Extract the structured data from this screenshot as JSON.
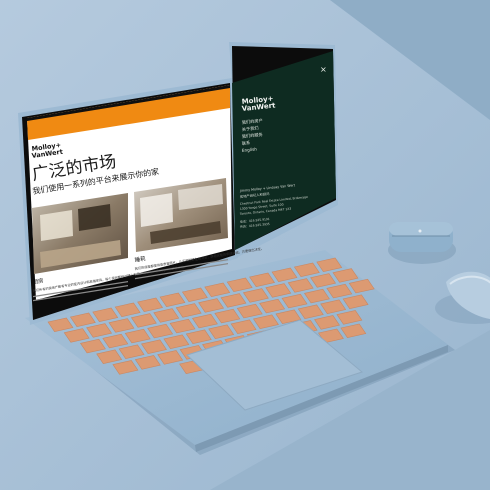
{
  "website": {
    "logo_line1": "Molloy+",
    "logo_line2": "VanWert",
    "headline": "广泛的市场",
    "subheadline": "我们使用一系列的平台来展示你的家",
    "caption_left": "厨房",
    "caption_right": "睡莉",
    "body_left": "我们所有的房地产都有专业的室内设计和高端家具。每个房间都经过精心布置，确保空间感和光线的最佳体验。",
    "body_right": "我们的房屋都提供高质量照片，让买家能够在线浏览，获得完整的家居体验，方便做出决定。",
    "menu": {
      "logo_line1": "Molloy+",
      "logo_line2": "VanWert",
      "close_glyph": "×",
      "items": [
        "我们的房产",
        "关于我们",
        "我们的服务",
        "联系",
        "English"
      ],
      "contact_name": "Jimmy Molloy + Lindsay Van Wert",
      "contact_title": "房地产经纪人和顾问",
      "address_1": "Chestnut Park Real Estate Limited, Brokerage",
      "address_2": "1300 Yonge Street, Suite 100",
      "address_3": "Toronto, Ontario, Canada M4T 1X3",
      "phone_1": "电话：416.925.9191",
      "phone_2": "传真：416.925.3935"
    }
  },
  "colors": {
    "backdrop": "#a9c2d6",
    "desk_shadow": "#7f9db7",
    "laptop_body": "#9dbad3",
    "keys": "#dc9a72",
    "orange_bar": "#f08a12",
    "menu_panel": "#0e2b21",
    "earbuds_case": "#8fb1cc",
    "mouse": "#b7cde0"
  },
  "icons": [
    "close-icon"
  ]
}
